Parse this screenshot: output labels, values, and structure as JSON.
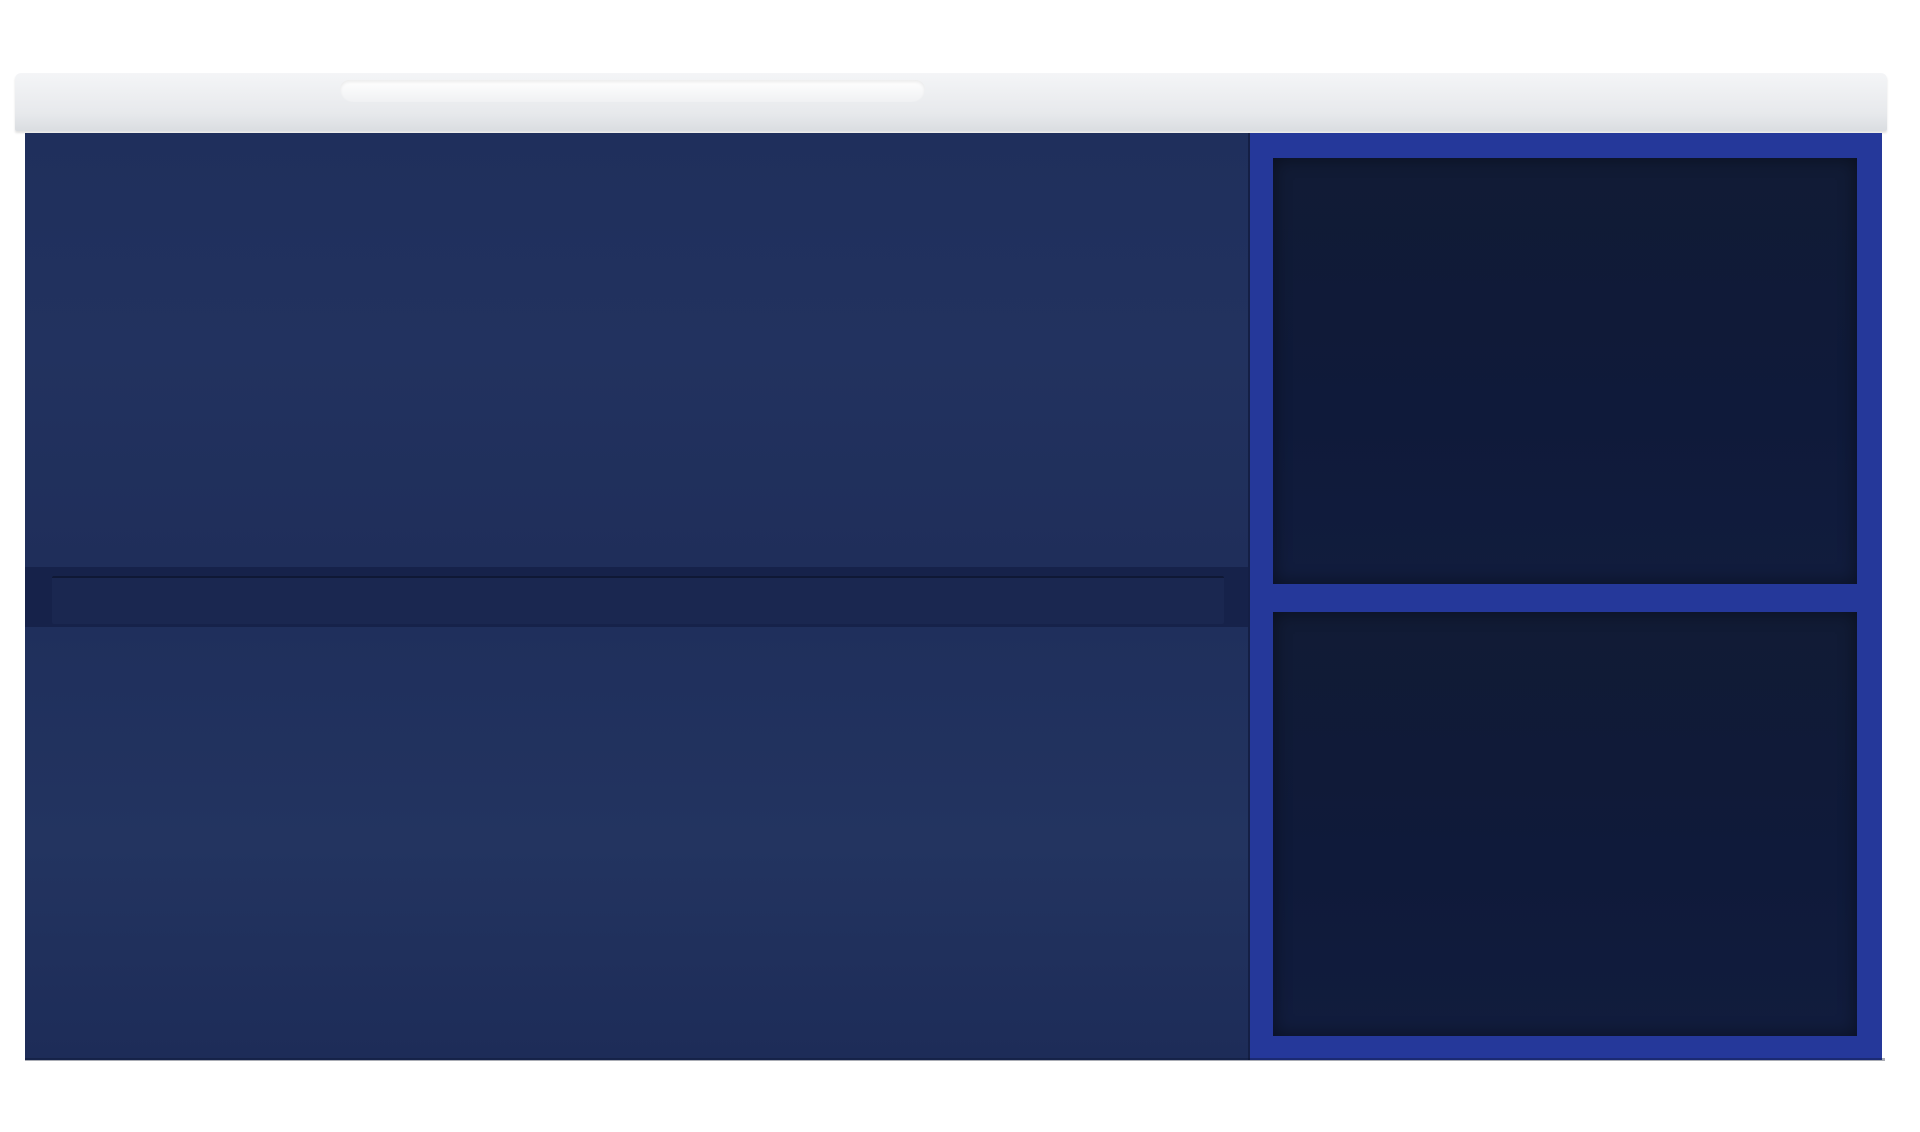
{
  "image": {
    "subject": "",
    "colors": {
      "cabinet": "#1f2f5c",
      "shelf_frame": "#25389a",
      "shelf_interior": "#101a38",
      "countertop": "#eceef0",
      "background": "#ffffff"
    }
  }
}
